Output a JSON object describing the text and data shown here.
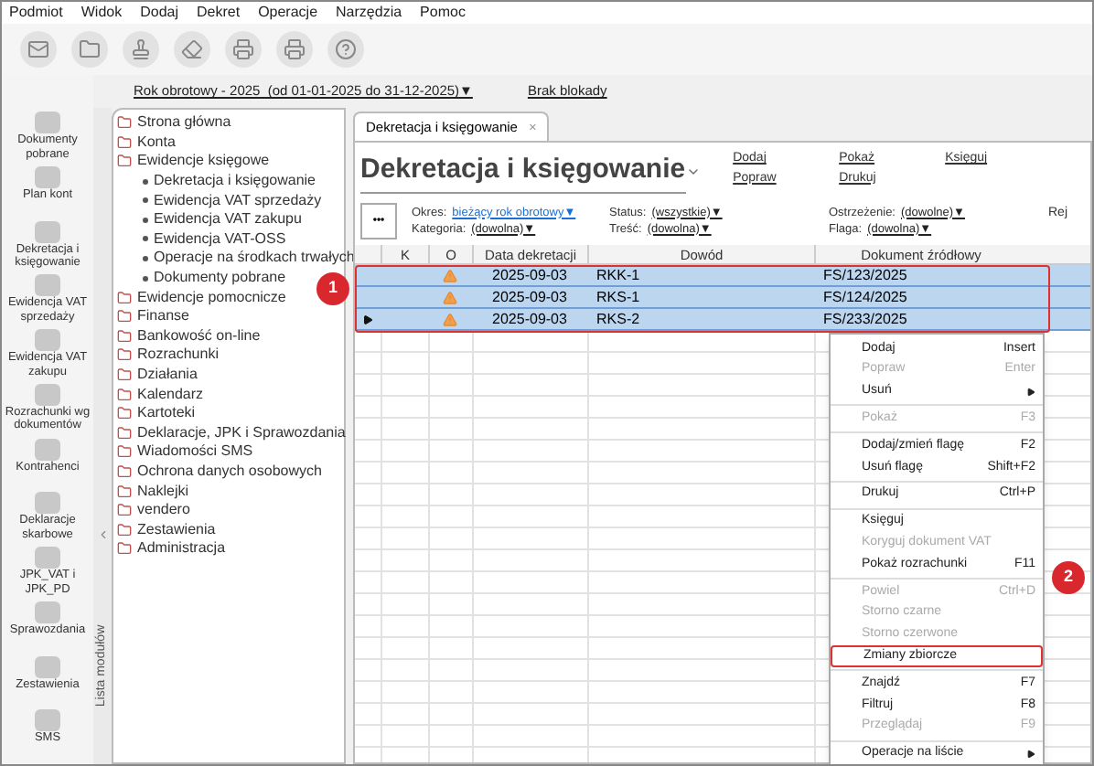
{
  "menu_bar": [
    "Podmiot",
    "Widok",
    "Dodaj",
    "Dekret",
    "Operacje",
    "Narzędzia",
    "Pomoc"
  ],
  "header": {
    "period": "Rok obrotowy - 2025  (od 01-01-2025 do 31-12-2025)▼",
    "lock": "Brak blokady"
  },
  "module_bar": {
    "label": "Lista modułów",
    "items": [
      "Dokumenty pobrane",
      "Plan kont",
      "Dekretacja i księgowanie",
      "Ewidencja VAT sprzedaży",
      "Ewidencja VAT zakupu",
      "Rozrachunki wg dokumentów",
      "Kontrahenci",
      "Deklaracje skarbowe",
      "JPK_VAT i JPK_PD",
      "Sprawozdania",
      "Zestawienia",
      "SMS"
    ]
  },
  "tree": [
    {
      "label": "Strona główna"
    },
    {
      "label": "Konta"
    },
    {
      "label": "Ewidencje księgowe",
      "children": [
        {
          "label": "Dekretacja i księgowanie"
        },
        {
          "label": "Ewidencja VAT sprzedaży"
        },
        {
          "label": "Ewidencja VAT zakupu"
        },
        {
          "label": "Ewidencja VAT-OSS"
        },
        {
          "label": "Operacje na środkach trwałych"
        },
        {
          "label": "Dokumenty pobrane"
        }
      ]
    },
    {
      "label": "Ewidencje pomocnicze"
    },
    {
      "label": "Finanse"
    },
    {
      "label": "Bankowość on-line"
    },
    {
      "label": "Rozrachunki"
    },
    {
      "label": "Działania"
    },
    {
      "label": "Kalendarz"
    },
    {
      "label": "Kartoteki"
    },
    {
      "label": "Deklaracje, JPK i Sprawozdania"
    },
    {
      "label": "Wiadomości SMS"
    },
    {
      "label": "Ochrona danych osobowych"
    },
    {
      "label": "Naklejki"
    },
    {
      "label": "vendero"
    },
    {
      "label": "Zestawienia"
    },
    {
      "label": "Administracja"
    }
  ],
  "tab": {
    "label": "Dekretacja i księgowanie",
    "close": "×"
  },
  "page_title": "Dekretacja i księgowanie",
  "actions": [
    [
      "Dodaj",
      "Popraw"
    ],
    [
      "Pokaż",
      "Drukuj"
    ],
    [
      "Księguj"
    ]
  ],
  "more_button": "•••",
  "filters": [
    [
      {
        "label": "Okres:",
        "value": "bieżący rok obrotowy▼",
        "highlighted": true
      },
      {
        "label": "Kategoria:",
        "value": "(dowolna)▼",
        "highlighted": false
      }
    ],
    [
      {
        "label": "Status:",
        "value": "(wszystkie)▼",
        "highlighted": false
      },
      {
        "label": "Treść:",
        "value": "(dowolna)▼",
        "highlighted": false
      }
    ],
    [
      {
        "label": "Ostrzeżenie:",
        "value": "(dowolne)▼",
        "highlighted": false
      },
      {
        "label": "Flaga:",
        "value": "(dowolna)▼",
        "highlighted": false
      }
    ]
  ],
  "filters_cut_label": "Rej",
  "table": {
    "columns": [
      "K",
      "O",
      "Data dekretacji",
      "Dowód",
      "Dokument źródłowy"
    ],
    "rows": [
      {
        "date": "2025-09-03",
        "proof": "RKK-1",
        "source": "FS/123/2025",
        "warning": true,
        "selected": true,
        "current": false
      },
      {
        "date": "2025-09-03",
        "proof": "RKS-1",
        "source": "FS/124/2025",
        "warning": true,
        "selected": true,
        "current": false
      },
      {
        "date": "2025-09-03",
        "proof": "RKS-2",
        "source": "FS/233/2025",
        "warning": true,
        "selected": true,
        "current": true
      }
    ]
  },
  "context_menu": [
    [
      {
        "label": "Dodaj",
        "shortcut": "Insert",
        "disabled": false,
        "submenu": false,
        "selected": false
      },
      {
        "label": "Popraw",
        "shortcut": "Enter",
        "disabled": true,
        "submenu": false,
        "selected": false
      },
      {
        "label": "Usuń",
        "disabled": false,
        "submenu": true,
        "selected": false
      }
    ],
    [
      {
        "label": "Pokaż",
        "shortcut": "F3",
        "disabled": true,
        "submenu": false,
        "selected": false
      }
    ],
    [
      {
        "label": "Dodaj/zmień flagę",
        "shortcut": "F2",
        "disabled": false,
        "submenu": false,
        "selected": false
      },
      {
        "label": "Usuń flagę",
        "shortcut": "Shift+F2",
        "disabled": false,
        "submenu": false,
        "selected": false
      }
    ],
    [
      {
        "label": "Drukuj",
        "shortcut": "Ctrl+P",
        "disabled": false,
        "submenu": false,
        "selected": false
      }
    ],
    [
      {
        "label": "Księguj",
        "disabled": false,
        "submenu": false,
        "selected": false
      },
      {
        "label": "Koryguj dokument VAT",
        "disabled": true,
        "submenu": false,
        "selected": false
      },
      {
        "label": "Pokaż rozrachunki",
        "shortcut": "F11",
        "disabled": false,
        "submenu": false,
        "selected": false
      }
    ],
    [
      {
        "label": "Powiel",
        "shortcut": "Ctrl+D",
        "disabled": true,
        "submenu": false,
        "selected": false
      },
      {
        "label": "Storno czarne",
        "disabled": true,
        "submenu": false,
        "selected": false
      },
      {
        "label": "Storno czerwone",
        "disabled": true,
        "submenu": false,
        "selected": false
      },
      {
        "label": "Zmiany zbiorcze",
        "disabled": false,
        "submenu": false,
        "selected": true
      }
    ],
    [
      {
        "label": "Znajdź",
        "shortcut": "F7",
        "disabled": false,
        "submenu": false,
        "selected": false
      },
      {
        "label": "Filtruj",
        "shortcut": "F8",
        "disabled": false,
        "submenu": false,
        "selected": false
      },
      {
        "label": "Przeglądaj",
        "shortcut": "F9",
        "disabled": true,
        "submenu": false,
        "selected": false
      }
    ],
    [
      {
        "label": "Operacje na liście",
        "disabled": false,
        "submenu": true,
        "selected": false
      }
    ]
  ],
  "callouts": [
    "1",
    "2"
  ]
}
